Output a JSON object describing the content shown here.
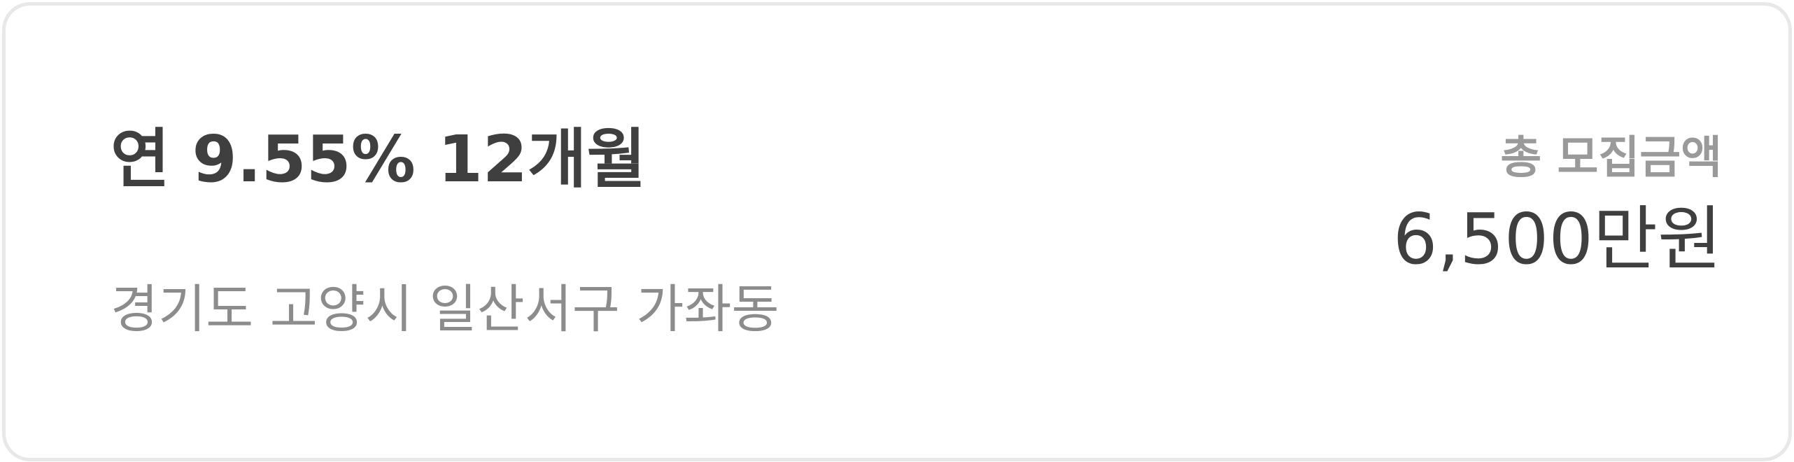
{
  "card": {
    "title": "연 9.55% 12개월",
    "location": "경기도 고양시 일산서구 가좌동",
    "total_amount_label": "총 모집금액",
    "total_amount_value": "6,500만원"
  },
  "colors": {
    "border": "#e8e8e8",
    "text_dark": "#3f3f3f",
    "text_gray": "#8c8c8c",
    "label_gray": "#9a9a9a",
    "background": "#ffffff"
  }
}
